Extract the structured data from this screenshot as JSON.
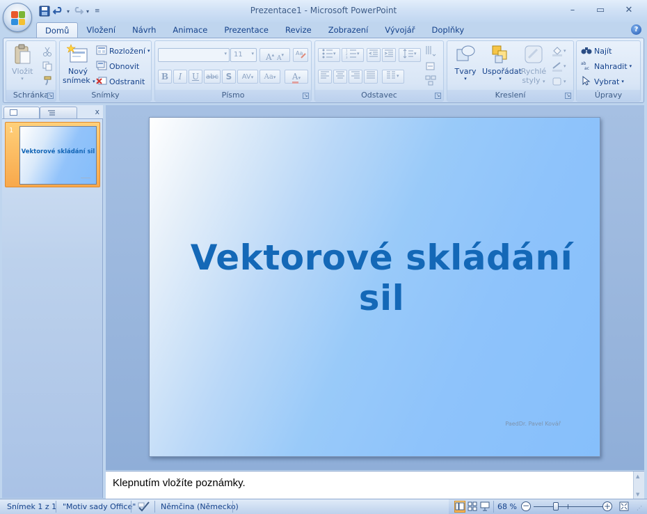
{
  "window": {
    "title": "Prezentace1 - Microsoft PowerPoint",
    "minimize": "–",
    "maximize": "▭",
    "close": "✕"
  },
  "qat": {
    "save_icon": "save-icon",
    "undo_icon": "undo-icon",
    "redo_icon": "redo-icon",
    "customize_icon": "customize-qat-icon"
  },
  "tabs": [
    {
      "label": "Domů",
      "active": true
    },
    {
      "label": "Vložení"
    },
    {
      "label": "Návrh"
    },
    {
      "label": "Animace"
    },
    {
      "label": "Prezentace"
    },
    {
      "label": "Revize"
    },
    {
      "label": "Zobrazení"
    },
    {
      "label": "Vývojář"
    },
    {
      "label": "Doplňky"
    }
  ],
  "ribbon": {
    "clipboard": {
      "label": "Schránka",
      "paste": "Vložit"
    },
    "slides": {
      "label": "Snímky",
      "new_slide_line1": "Nový",
      "new_slide_line2": "snímek",
      "layout": "Rozložení",
      "reset": "Obnovit",
      "delete": "Odstranit"
    },
    "font": {
      "label": "Písmo",
      "font_name": "",
      "font_size": "11",
      "grow": "A",
      "shrink": "A",
      "bold": "B",
      "italic": "I",
      "underline": "U",
      "strike": "abc",
      "shadow": "S",
      "spacing": "AV",
      "case": "Aa",
      "color": "A"
    },
    "paragraph": {
      "label": "Odstavec"
    },
    "drawing": {
      "label": "Kreslení",
      "shapes": "Tvary",
      "arrange": "Uspořádat",
      "quick_styles_line1": "Rychlé",
      "quick_styles_line2": "styly"
    },
    "editing": {
      "label": "Úpravy",
      "find": "Najít",
      "replace": "Nahradit",
      "select": "Vybrat"
    }
  },
  "slide_panel": {
    "close": "x",
    "slides": [
      {
        "number": "1",
        "title": "Vektorové skládání sil"
      }
    ]
  },
  "slide": {
    "title": "Vektorové skládání sil",
    "author": "PaedDr. Pavel Kovář"
  },
  "notes": {
    "placeholder": "Klepnutím vložíte poznámky."
  },
  "status": {
    "slide_info": "Snímek 1 z 1",
    "theme": "\"Motiv sady Office\"",
    "language": "Němčina (Německo)",
    "zoom": "68 %",
    "zoom_percent": 68
  },
  "colors": {
    "accent": "#15428b",
    "slide_title": "#1468b7",
    "selected_thumb": "#f8a84b"
  }
}
